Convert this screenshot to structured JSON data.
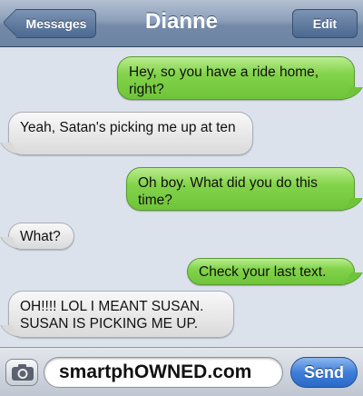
{
  "header": {
    "title": "Dianne",
    "back_label": "Messages",
    "edit_label": "Edit"
  },
  "messages": [
    {
      "direction": "outgoing",
      "text": "Hey, so you have a ride home, right?"
    },
    {
      "direction": "incoming",
      "text": "Yeah, Satan's picking me up at ten"
    },
    {
      "direction": "outgoing",
      "text": "Oh boy. What did you do this time?"
    },
    {
      "direction": "incoming",
      "text": "What?"
    },
    {
      "direction": "outgoing",
      "text": "Check your last text."
    },
    {
      "direction": "incoming",
      "text": "OH!!!! LOL I MEANT SUSAN. SUSAN IS PICKING ME UP."
    }
  ],
  "composer": {
    "field_value": "smartphOWNED.com",
    "send_label": "Send",
    "camera_icon": "camera-icon"
  },
  "colors": {
    "outgoing_bubble": "#82d34a",
    "incoming_bubble": "#e6e6e6",
    "nav_bar": "#7489a8",
    "send_button": "#3f7ed8",
    "background": "#dbe2ec"
  }
}
